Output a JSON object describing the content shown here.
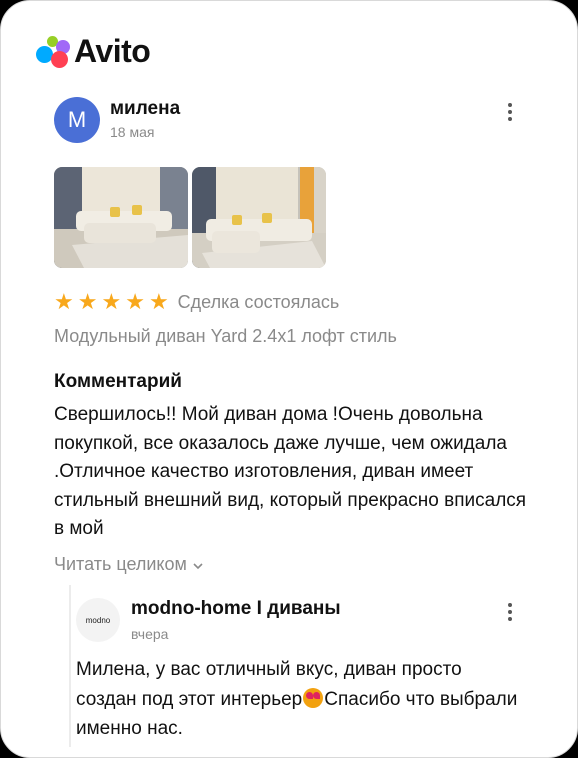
{
  "brand": {
    "name": "Avito"
  },
  "review": {
    "avatar_letter": "М",
    "author": "милена",
    "date": "18 мая",
    "rating": 5,
    "deal_status": "Сделка состоялась",
    "product": "Модульный диван Yard 2.4x1 лофт стиль",
    "comment_title": "Комментарий",
    "comment_text": "Свершилось!! Мой диван дома !Очень довольна покупкой, все оказалось даже лучше, чем ожидала .Отличное качество изготовления, диван имеет стильный внешний вид, который прекрасно вписался в мой",
    "read_more": "Читать целиком"
  },
  "reply": {
    "avatar_text": "modno",
    "author": "modno-home I диваны",
    "date": "вчера",
    "text_before": "Милена, у вас отличный вкус, диван просто создан под этот интерьер",
    "text_after": "Спасибо что выбрали именно нас."
  },
  "colors": {
    "star": "#f8a81c",
    "avatar": "#4a6fd6",
    "muted": "#8a8a8a"
  },
  "icons": [
    "avito-logo-icon",
    "more-vertical-icon",
    "star-icon",
    "chevron-down-icon",
    "smiling-face-with-heart-eyes-icon"
  ]
}
